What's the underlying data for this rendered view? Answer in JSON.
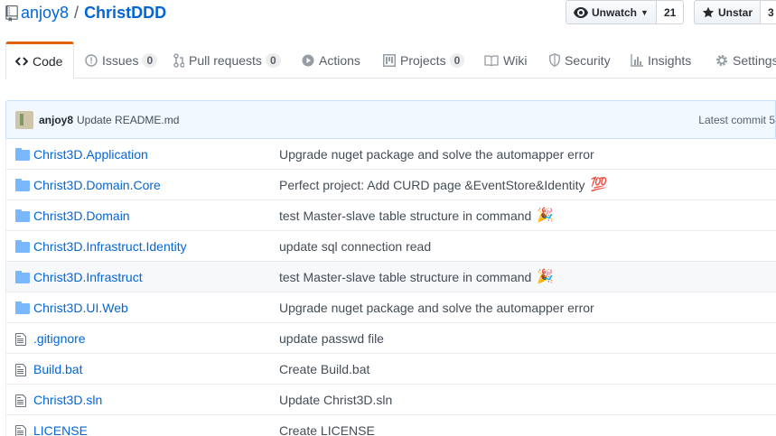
{
  "repo": {
    "owner": "anjoy8",
    "separator": "/",
    "name": "ChristDDD"
  },
  "actions": {
    "watch_label": "Unwatch",
    "watch_count": "21",
    "star_label": "Unstar",
    "star_count": "3"
  },
  "tabs": [
    {
      "label": "Code",
      "icon": "code-icon"
    },
    {
      "label": "Issues",
      "count": "0",
      "icon": "issue-icon"
    },
    {
      "label": "Pull requests",
      "count": "0",
      "icon": "pull-request-icon"
    },
    {
      "label": "Actions",
      "icon": "play-icon"
    },
    {
      "label": "Projects",
      "count": "0",
      "icon": "project-icon"
    },
    {
      "label": "Wiki",
      "icon": "book-icon"
    },
    {
      "label": "Security",
      "icon": "shield-icon"
    },
    {
      "label": "Insights",
      "icon": "graph-icon"
    },
    {
      "label": "Settings",
      "icon": "gear-icon"
    }
  ],
  "commit": {
    "author": "anjoy8",
    "message": "Update README.md",
    "latest": "Latest commit 5"
  },
  "files": [
    {
      "type": "dir",
      "name": "Christ3D.Application",
      "message": "Upgrade nuget package and solve the automapper error",
      "emoji": ""
    },
    {
      "type": "dir",
      "name": "Christ3D.Domain.Core",
      "message": "Perfect project: Add CURD page &EventStore&Identity",
      "emoji": "💯"
    },
    {
      "type": "dir",
      "name": "Christ3D.Domain",
      "message": "test Master-slave table structure in command",
      "emoji": "🎉"
    },
    {
      "type": "dir",
      "name": "Christ3D.Infrastruct.Identity",
      "message": "update sql connection read",
      "emoji": ""
    },
    {
      "type": "dir",
      "name": "Christ3D.Infrastruct",
      "message": "test Master-slave table structure in command",
      "emoji": "🎉"
    },
    {
      "type": "dir",
      "name": "Christ3D.UI.Web",
      "message": "Upgrade nuget package and solve the automapper error",
      "emoji": ""
    },
    {
      "type": "file",
      "name": ".gitignore",
      "message": "update passwd file",
      "emoji": ""
    },
    {
      "type": "file",
      "name": "Build.bat",
      "message": "Create Build.bat",
      "emoji": ""
    },
    {
      "type": "file",
      "name": "Christ3D.sln",
      "message": "Update Christ3D.sln",
      "emoji": ""
    },
    {
      "type": "file",
      "name": "LICENSE",
      "message": "Create LICENSE",
      "emoji": ""
    }
  ],
  "colors": {
    "link": "#0366d6",
    "tab_accent": "#e36209",
    "commit_bg": "#f1f8ff",
    "folder": "#79b8ff"
  }
}
